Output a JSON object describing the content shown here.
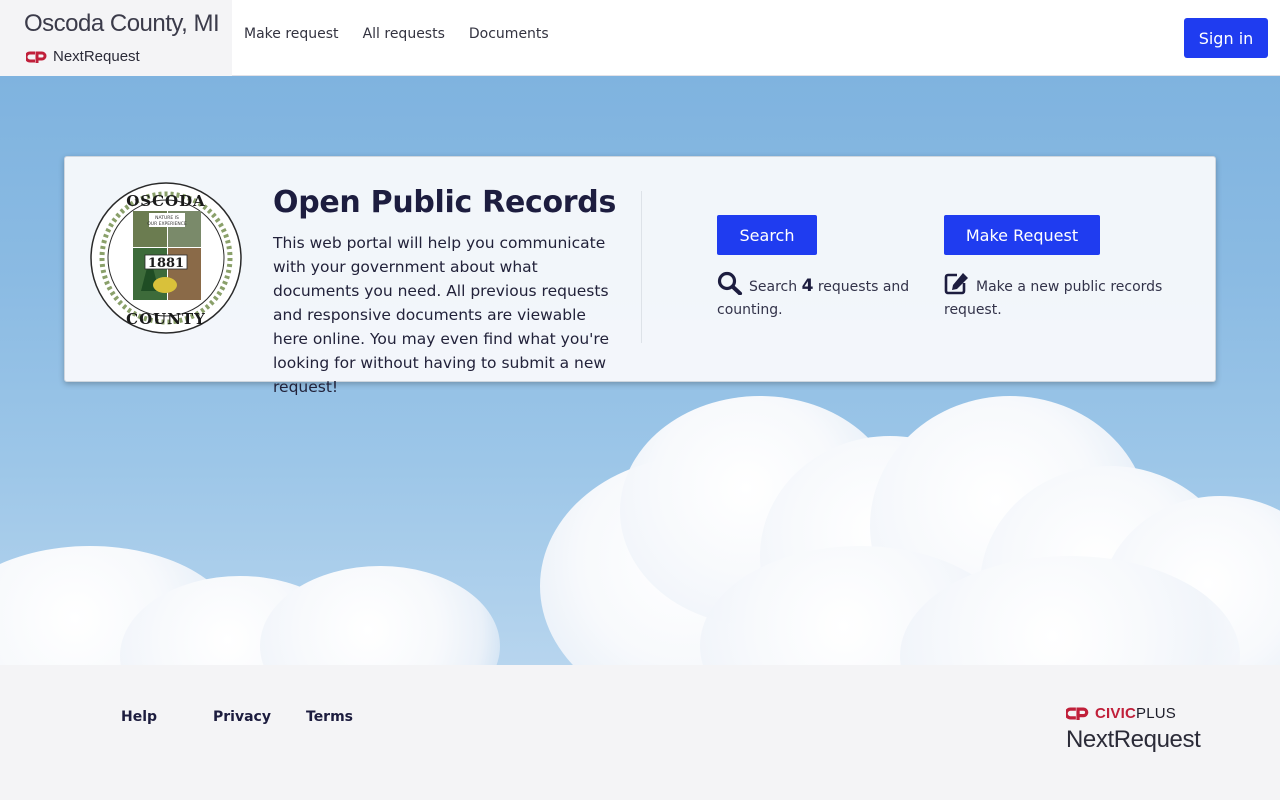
{
  "header": {
    "site_title": "Oscoda County, MI",
    "brand_name": "NextRequest",
    "nav": [
      {
        "label": "Make request"
      },
      {
        "label": "All requests"
      },
      {
        "label": "Documents"
      }
    ],
    "sign_in_label": "Sign in"
  },
  "card": {
    "seal": {
      "top_text": "OSCODA",
      "bottom_text": "COUNTY",
      "banner_text_1": "NATURE IS",
      "banner_text_2": "OUR EXPERIENCE",
      "year": "1881"
    },
    "title": "Open Public Records",
    "description": "This web portal will help you communicate with your government about what documents you need. All previous requests and responsive documents are viewable here online. You may even find what you're looking for without having to submit a new request!",
    "search_button": "Search",
    "search_info_prefix": "Search",
    "search_count": "4",
    "search_info_suffix": "requests and counting.",
    "make_button": "Make Request",
    "make_info": "Make a new public records request."
  },
  "footer": {
    "links": [
      {
        "label": "Help"
      },
      {
        "label": "Privacy"
      },
      {
        "label": "Terms"
      }
    ],
    "civic_brand": "CIVIC",
    "civic_plus": "PLUS",
    "product": "NextRequest"
  },
  "colors": {
    "primary": "#1f3cf0",
    "brand_red": "#c01f3a",
    "text_dark": "#1d1d3f",
    "sky": "#8bbbe3"
  },
  "icons": {
    "search": "search-icon",
    "edit": "edit-icon",
    "logo": "civicplus-logo-icon"
  }
}
